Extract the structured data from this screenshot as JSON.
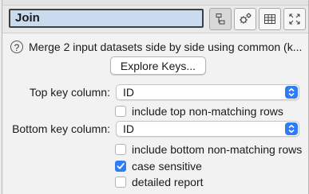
{
  "title": "Join",
  "toolbar": {
    "icons": [
      "node-tree-icon",
      "gear-icon",
      "table-icon",
      "expand-icon"
    ]
  },
  "description": "Merge 2 input datasets side by side using common (k...",
  "explore_button": "Explore Keys...",
  "top_key": {
    "label": "Top key column:",
    "value": "ID",
    "include_label": "include top non-matching rows",
    "include_checked": false
  },
  "bottom_key": {
    "label": "Bottom key column:",
    "value": "ID",
    "include_label": "include bottom non-matching rows",
    "include_checked": false
  },
  "options": {
    "case_sensitive_label": "case sensitive",
    "case_sensitive_checked": true,
    "detailed_report_label": "detailed report",
    "detailed_report_checked": false
  },
  "colors": {
    "accent": "#2f7cf6",
    "title_field": "#c9dbef"
  }
}
